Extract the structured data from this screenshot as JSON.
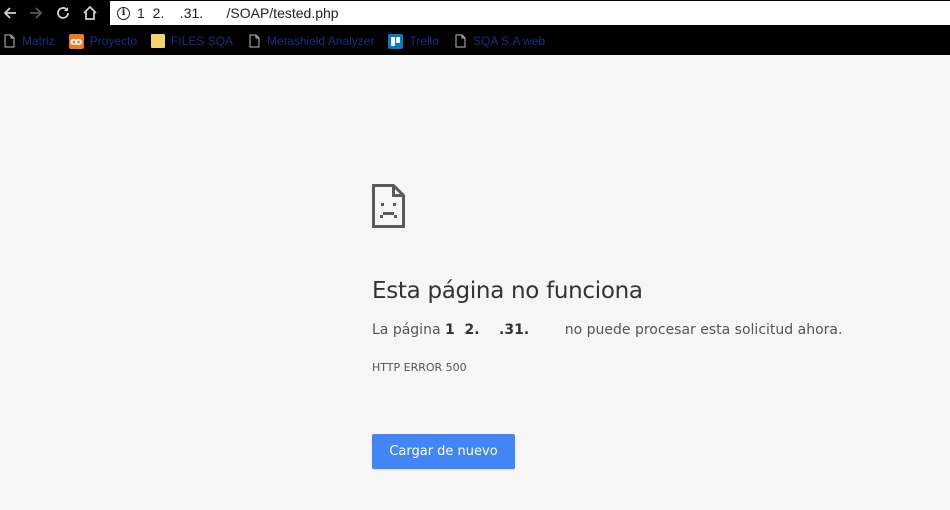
{
  "browser": {
    "url_prefix": "1  2.    .31.",
    "url_path": "      /SOAP/tested.php"
  },
  "bookmarks": [
    {
      "label": "Matriz",
      "icon": "document-icon"
    },
    {
      "label": "Proyecto",
      "icon": "xampp-icon"
    },
    {
      "label": "FILES SQA",
      "icon": "folder-icon"
    },
    {
      "label": "Metashield Analyzer",
      "icon": "document-icon"
    },
    {
      "label": "Trello",
      "icon": "trello-icon"
    },
    {
      "label": "SQA S.A web",
      "icon": "document-icon"
    }
  ],
  "error": {
    "title": "Esta página no funciona",
    "desc_prefix": "La página ",
    "desc_host": "1  2.    .31.",
    "desc_suffix": "        no puede procesar esta solicitud ahora.",
    "code": "HTTP ERROR 500"
  },
  "reload": {
    "label": "Cargar de nuevo"
  },
  "colors": {
    "accent": "#4285f4",
    "page_bg": "#f6f6f6",
    "chrome_bg": "#000000"
  }
}
